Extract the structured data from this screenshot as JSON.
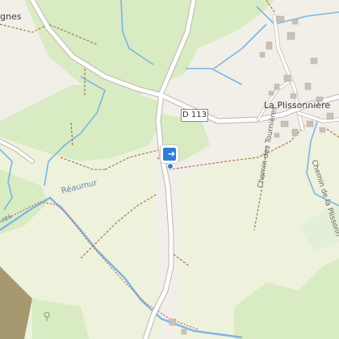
{
  "map": {
    "road_label": "D 113",
    "places": {
      "village": "La Plissonnière",
      "partial_place": "gnes",
      "river": "Réaumur",
      "river_cut": "res"
    },
    "streets": {
      "chemin_tournieres": "Chemin des Tournières",
      "chemin_plissonniere": "Chemin de la Plissonn"
    },
    "marker": {
      "icon": "directions-icon"
    },
    "colors": {
      "land": "#f2efe9",
      "forest": "#d8ebc3",
      "field": "#eef1dc",
      "water": "#7cb6e0",
      "road": "#ffffff",
      "track": "#a0703a",
      "building": "#c9c1b8",
      "marker": "#2f7fd8"
    }
  }
}
